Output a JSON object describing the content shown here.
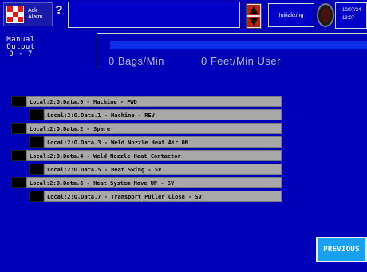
{
  "header": {
    "ack_alarm_label_line1": "Ack",
    "ack_alarm_label_line2": "Alarm",
    "help_label": "?",
    "status_text": "Initializing",
    "date": "10/07/24",
    "time": "13:07"
  },
  "manual_output": {
    "line1": "Manual",
    "line2": "Output",
    "line3": "0 - 7"
  },
  "rates": {
    "bags_per_min": "0 Bags/Min",
    "feet_per_min": "0 Feet/Min User"
  },
  "outputs": [
    {
      "label": "Local:2:O.Data.0 - Machine - FWD"
    },
    {
      "label": "Local:2:O.Data.1 - Machine - REV"
    },
    {
      "label": "Local:2:O.Data.2 - Spare"
    },
    {
      "label": "Local:2:O.Data.3 - Weld Nozzle Heat Air ON"
    },
    {
      "label": "Local:2:O.Data.4 - Weld Nozzle Heat Contactor"
    },
    {
      "label": "Local:2:O.Data.5 - Heat Swing - SV"
    },
    {
      "label": "Local:2:O.Data.6 - Heat System Move UP - SV"
    },
    {
      "label": "Local:2:O.Data.7 - Transport Puller Close - SV"
    }
  ],
  "buttons": {
    "previous": "PREVIOUS"
  },
  "icons": {
    "ack_alarm": "checkered-flag-icon",
    "scroll": "up-down-arrows-icon",
    "indicator": "status-knob-icon"
  },
  "colors": {
    "background": "#0000b8",
    "row_fill": "#a8a8a8",
    "previous_button": "#1aa0f0",
    "arrow_button": "#c02010"
  }
}
